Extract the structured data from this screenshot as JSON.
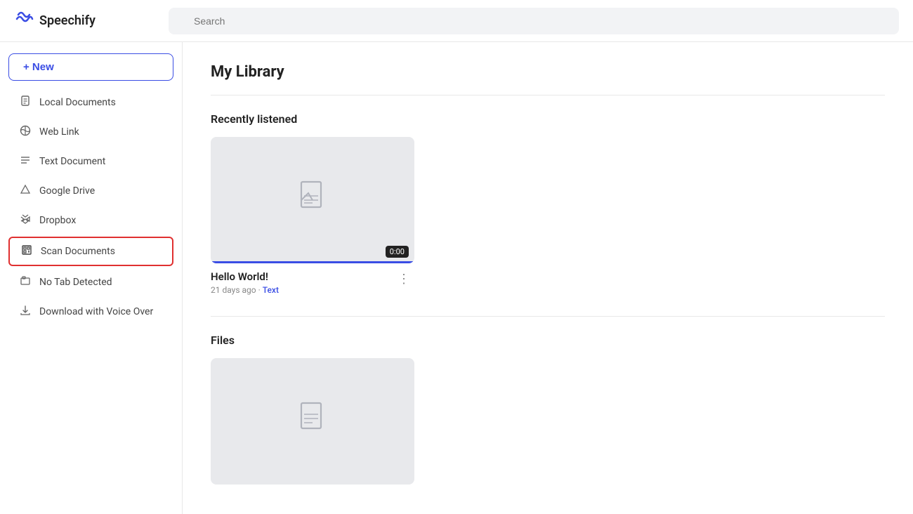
{
  "header": {
    "logo_text": "Speechify",
    "search_placeholder": "Search"
  },
  "sidebar": {
    "new_button": "+ New",
    "items": [
      {
        "id": "local-documents",
        "label": "Local Documents",
        "icon": "📄"
      },
      {
        "id": "web-link",
        "label": "Web Link",
        "icon": "☁"
      },
      {
        "id": "text-document",
        "label": "Text Document",
        "icon": "≡"
      },
      {
        "id": "google-drive",
        "label": "Google Drive",
        "icon": "△"
      },
      {
        "id": "dropbox",
        "label": "Dropbox",
        "icon": "✦"
      },
      {
        "id": "scan-documents",
        "label": "Scan Documents",
        "icon": "⊡",
        "highlighted": true
      },
      {
        "id": "no-tab-detected",
        "label": "No Tab Detected",
        "icon": "🖥"
      },
      {
        "id": "download-voice-over",
        "label": "Download with Voice Over",
        "icon": "⬇"
      }
    ]
  },
  "main": {
    "page_title": "My Library",
    "recently_listened_title": "Recently listened",
    "files_title": "Files",
    "cards": [
      {
        "id": "hello-world",
        "title": "Hello World!",
        "meta_time": "21 days ago",
        "meta_dot": "·",
        "meta_type": "Text",
        "time_badge": "0:00"
      }
    ]
  }
}
